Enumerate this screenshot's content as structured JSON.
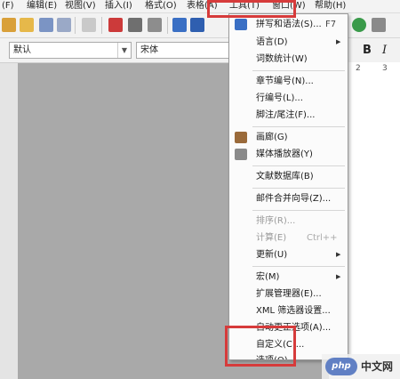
{
  "menubar": {
    "items": [
      "(F)",
      "编辑(E)",
      "视图(V)",
      "插入(I)",
      "格式(O)",
      "表格(A)",
      "工具(T)",
      "窗口(W)",
      "帮助(H)"
    ]
  },
  "toolbar": {
    "style_value": "默认",
    "font_value": "宋体",
    "bold_label": "B",
    "italic_label": "I",
    "ruler_marks": [
      "2",
      "3"
    ]
  },
  "tools_menu": {
    "items": [
      {
        "label": "拼写和语法(S)...",
        "shortcut": "F7",
        "icon": "spellcheck-icon",
        "has_sub": false,
        "disabled": false
      },
      {
        "label": "语言(D)",
        "shortcut": "",
        "icon": "",
        "has_sub": true,
        "disabled": false
      },
      {
        "label": "词数统计(W)",
        "shortcut": "",
        "icon": "",
        "has_sub": false,
        "disabled": false
      },
      {
        "label": "章节编号(N)...",
        "shortcut": "",
        "icon": "",
        "has_sub": false,
        "disabled": false
      },
      {
        "label": "行编号(L)...",
        "shortcut": "",
        "icon": "",
        "has_sub": false,
        "disabled": false
      },
      {
        "label": "脚注/尾注(F)...",
        "shortcut": "",
        "icon": "",
        "has_sub": false,
        "disabled": false
      },
      {
        "label": "画廊(G)",
        "shortcut": "",
        "icon": "gallery-icon",
        "has_sub": false,
        "disabled": false
      },
      {
        "label": "媒体播放器(Y)",
        "shortcut": "",
        "icon": "media-player-icon",
        "has_sub": false,
        "disabled": false
      },
      {
        "label": "文献数据库(B)",
        "shortcut": "",
        "icon": "",
        "has_sub": false,
        "disabled": false
      },
      {
        "label": "邮件合并向导(Z)...",
        "shortcut": "",
        "icon": "",
        "has_sub": false,
        "disabled": false
      },
      {
        "label": "排序(R)...",
        "shortcut": "",
        "icon": "",
        "has_sub": false,
        "disabled": true
      },
      {
        "label": "计算(E)",
        "shortcut": "Ctrl++",
        "icon": "",
        "has_sub": false,
        "disabled": true
      },
      {
        "label": "更新(U)",
        "shortcut": "",
        "icon": "",
        "has_sub": true,
        "disabled": false
      },
      {
        "label": "宏(M)",
        "shortcut": "",
        "icon": "",
        "has_sub": true,
        "disabled": false
      },
      {
        "label": "扩展管理器(E)...",
        "shortcut": "",
        "icon": "",
        "has_sub": false,
        "disabled": false
      },
      {
        "label": "XML 筛选器设置...",
        "shortcut": "",
        "icon": "",
        "has_sub": false,
        "disabled": false
      },
      {
        "label": "自动更正选项(A)...",
        "shortcut": "",
        "icon": "",
        "has_sub": false,
        "disabled": false
      },
      {
        "label": "自定义(C)...",
        "shortcut": "",
        "icon": "",
        "has_sub": false,
        "disabled": false
      },
      {
        "label": "选项(O)...",
        "shortcut": "",
        "icon": "",
        "has_sub": false,
        "disabled": false
      }
    ]
  },
  "watermark": {
    "logo_text": "php",
    "site_text": "中文网"
  },
  "colors": {
    "highlight_red": "#d63b3b",
    "workspace_gray": "#a9a9a9"
  }
}
